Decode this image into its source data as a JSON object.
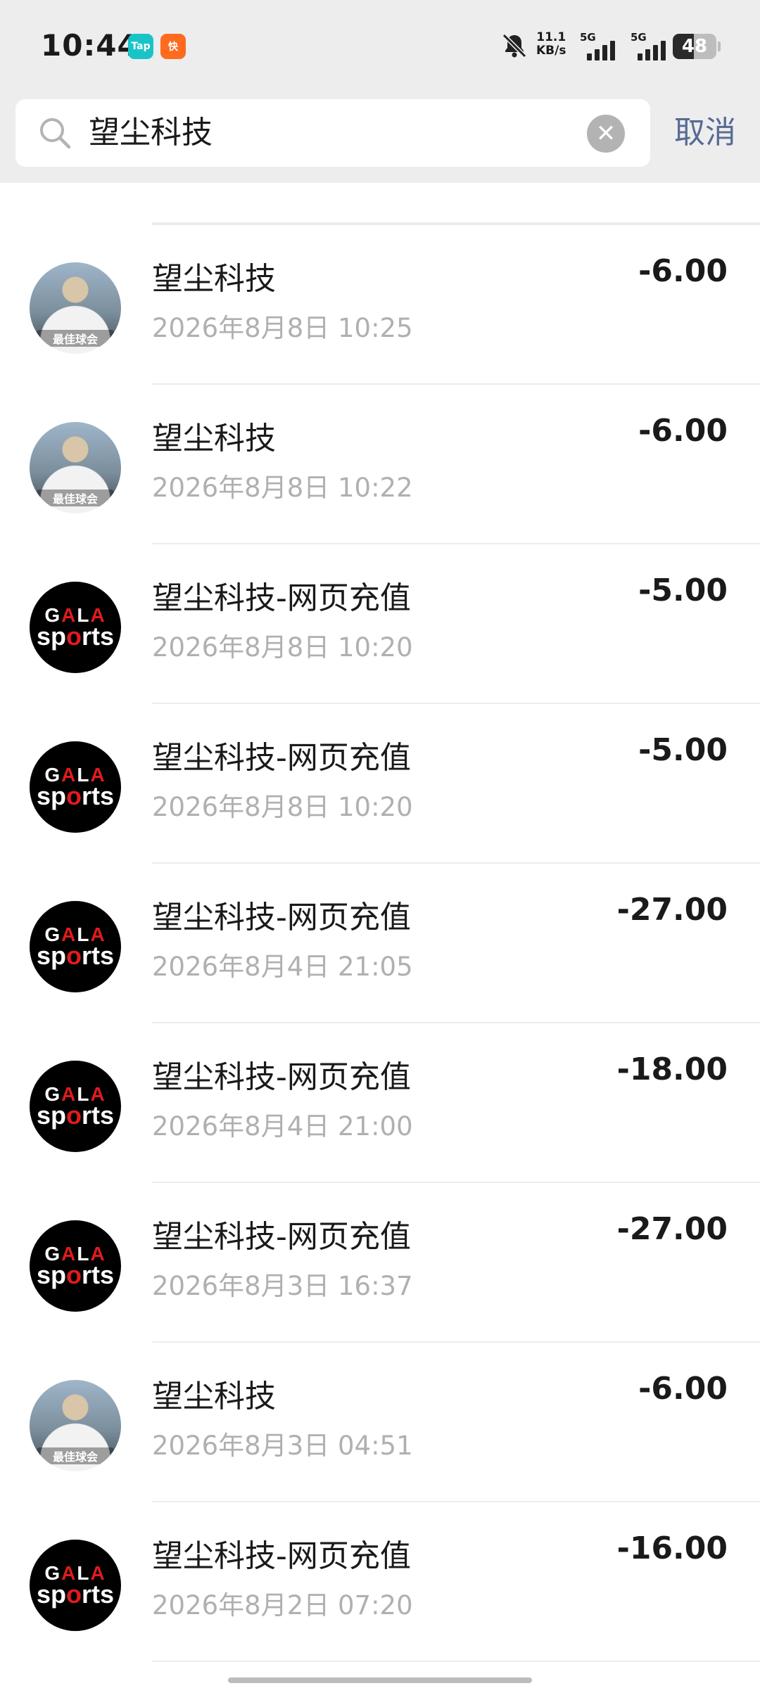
{
  "status_bar": {
    "time": "10:44",
    "app_badges": [
      "Tap",
      "快"
    ],
    "net_speed_value": "11.1",
    "net_speed_unit": "KB/s",
    "signal_1": "5G",
    "signal_2": "5G",
    "battery": "48"
  },
  "search": {
    "query": "望尘科技",
    "cancel_label": "取消"
  },
  "transactions": [
    {
      "title": "望尘科技",
      "time": "2026年8月8日 10:25",
      "amount": "-6.00",
      "avatar": "player-photo",
      "avatar_caption": "最佳球会"
    },
    {
      "title": "望尘科技",
      "time": "2026年8月8日 10:22",
      "amount": "-6.00",
      "avatar": "player-photo",
      "avatar_caption": "最佳球会"
    },
    {
      "title": "望尘科技-网页充值",
      "time": "2026年8月8日 10:20",
      "amount": "-5.00",
      "avatar": "gala-logo"
    },
    {
      "title": "望尘科技-网页充值",
      "time": "2026年8月8日 10:20",
      "amount": "-5.00",
      "avatar": "gala-logo"
    },
    {
      "title": "望尘科技-网页充值",
      "time": "2026年8月4日 21:05",
      "amount": "-27.00",
      "avatar": "gala-logo"
    },
    {
      "title": "望尘科技-网页充值",
      "time": "2026年8月4日 21:00",
      "amount": "-18.00",
      "avatar": "gala-logo"
    },
    {
      "title": "望尘科技-网页充值",
      "time": "2026年8月3日 16:37",
      "amount": "-27.00",
      "avatar": "gala-logo"
    },
    {
      "title": "望尘科技",
      "time": "2026年8月3日 04:51",
      "amount": "-6.00",
      "avatar": "player-photo",
      "avatar_caption": "最佳球会"
    },
    {
      "title": "望尘科技-网页充值",
      "time": "2026年8月2日 07:20",
      "amount": "-16.00",
      "avatar": "gala-logo"
    }
  ],
  "gala_logo": {
    "top": "GALA",
    "bottom": "sports"
  },
  "colors": {
    "link_blue": "#576b95",
    "header_bg": "#ededed",
    "gala_red": "#e21b1b"
  }
}
